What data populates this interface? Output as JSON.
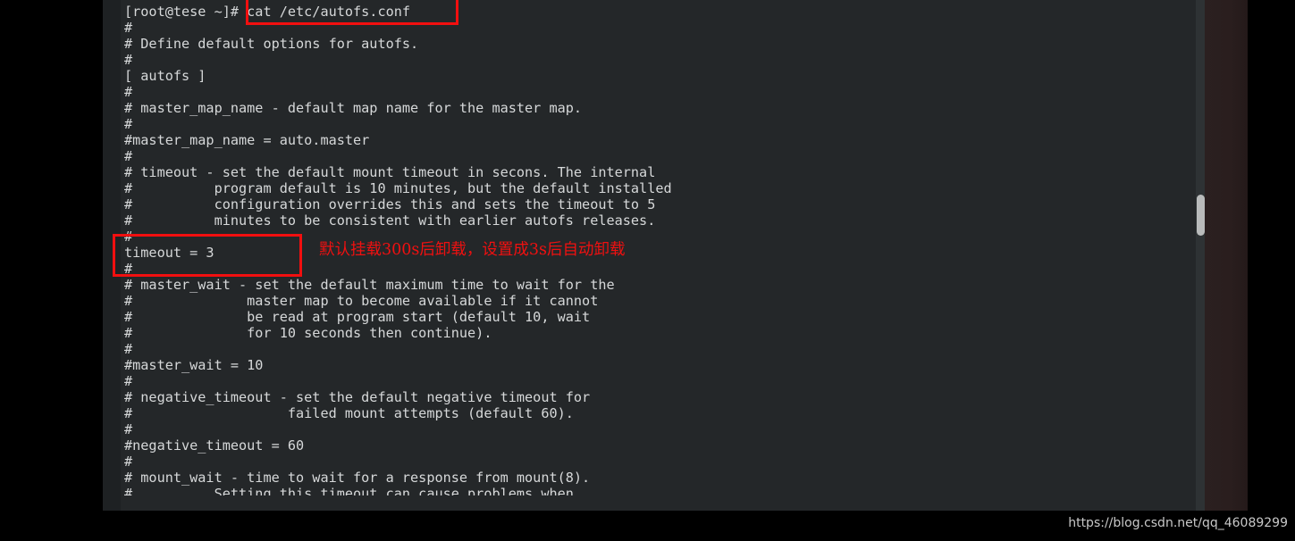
{
  "window": {
    "kind": "terminal",
    "background_color": "#242729",
    "text_color": "#d6d8d9"
  },
  "terminal": {
    "prompt": "[root@tese ~]# ",
    "command": "cat /etc/autofs.conf",
    "lines": [
      {
        "text": "",
        "partial": true
      },
      {
        "text": "[root@tese ~]# cat /etc/autofs.conf"
      },
      {
        "text": "#"
      },
      {
        "text": "# Define default options for autofs."
      },
      {
        "text": "#"
      },
      {
        "text": "[ autofs ]"
      },
      {
        "text": "#"
      },
      {
        "text": "# master_map_name - default map name for the master map."
      },
      {
        "text": "#"
      },
      {
        "text": "#master_map_name = auto.master"
      },
      {
        "text": "#"
      },
      {
        "text": "# timeout - set the default mount timeout in secons. The internal"
      },
      {
        "text": "#          program default is 10 minutes, but the default installed"
      },
      {
        "text": "#          configuration overrides this and sets the timeout to 5"
      },
      {
        "text": "#          minutes to be consistent with earlier autofs releases."
      },
      {
        "text": "#"
      },
      {
        "text": "timeout = 3"
      },
      {
        "text": "#"
      },
      {
        "text": "# master_wait - set the default maximum time to wait for the"
      },
      {
        "text": "#              master map to become available if it cannot"
      },
      {
        "text": "#              be read at program start (default 10, wait"
      },
      {
        "text": "#              for 10 seconds then continue)."
      },
      {
        "text": "#"
      },
      {
        "text": "#master_wait = 10"
      },
      {
        "text": "#"
      },
      {
        "text": "# negative_timeout - set the default negative timeout for"
      },
      {
        "text": "#                   failed mount attempts (default 60)."
      },
      {
        "text": "#"
      },
      {
        "text": "#negative_timeout = 60"
      },
      {
        "text": "#"
      },
      {
        "text": "# mount_wait - time to wait for a response from mount(8)."
      },
      {
        "text": "#          Setting this timeout can cause problems when",
        "clipped": true
      }
    ]
  },
  "annotations": {
    "color": "#f20f0f",
    "note_text": "默认挂载300s后卸载，设置成3s后自动卸载",
    "command_box_label": "cat /etc/autofs.conf",
    "timeout_box_label": "timeout = 3"
  },
  "scrollbar": {
    "orientation": "vertical",
    "thumb_color": "#b9bbbb",
    "track_color": "#2e3234"
  },
  "watermark": {
    "text": "https://blog.csdn.net/qq_46089299"
  }
}
